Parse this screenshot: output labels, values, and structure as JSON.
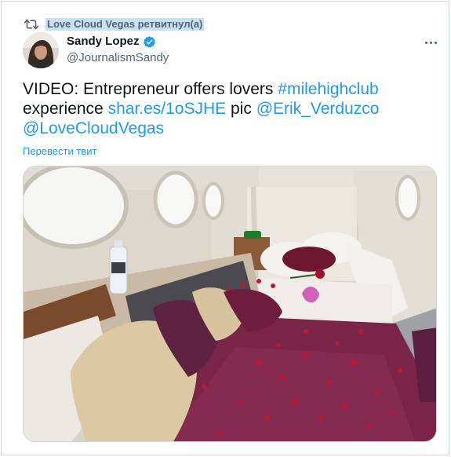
{
  "retweet": {
    "label": "Love Cloud Vegas ретвитнул(а)",
    "icon": "retweet-icon"
  },
  "author": {
    "name": "Sandy Lopez",
    "handle": "@JournalismSandy",
    "verified_icon": "verified-badge-icon",
    "avatar": "avatar"
  },
  "tweet": {
    "t1": "VIDEO: Entrepreneur offers lovers ",
    "l1": "#milehighclub",
    "t2": "experience ",
    "l2": "shar.es/1oSJHE",
    "t3": " pic ",
    "l3": "@Erik_Verduzco",
    "l4": "@LoveCloudVegas",
    "translate": "Перевести твит"
  },
  "more_icon": "more-icon",
  "colors": {
    "link": "#1d9bf0",
    "secondary": "#536471",
    "text": "#0f1419",
    "highlight": "#c9dff6"
  }
}
